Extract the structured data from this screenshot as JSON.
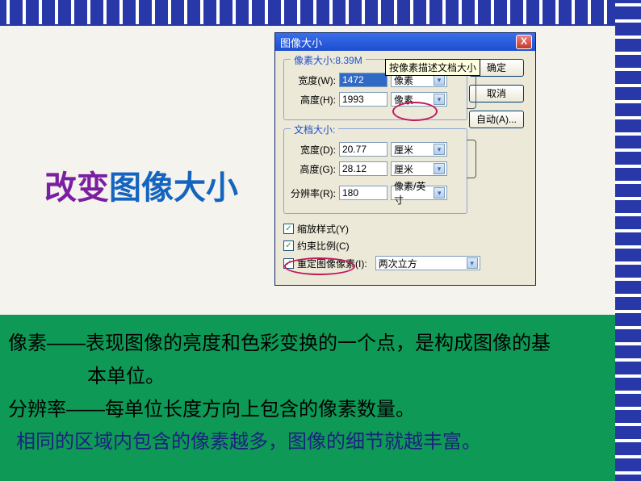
{
  "slide": {
    "title_part1": "改变",
    "title_part2": "图像大小"
  },
  "dialog": {
    "title": "图像大小",
    "close_label": "X"
  },
  "pixel_section": {
    "legend": "像素大小:8.39M",
    "width_label": "宽度(W):",
    "width_value": "1472",
    "height_label": "高度(H):",
    "height_value": "1993",
    "unit_width": "像素",
    "unit_height": "像素",
    "tooltip": "按像素描述文档大小"
  },
  "doc_section": {
    "legend": "文档大小:",
    "width_label": "宽度(D):",
    "width_value": "20.77",
    "height_label": "高度(G):",
    "height_value": "28.12",
    "res_label": "分辨率(R):",
    "res_value": "180",
    "unit_dim": "厘米",
    "unit_res": "像素/英寸"
  },
  "checkboxes": {
    "scale_styles": "缩放样式(Y)",
    "constrain": "约束比例(C)",
    "resample": "重定图像像素(I):",
    "resample_method": "两次立方"
  },
  "buttons": {
    "ok": "确定",
    "cancel": "取消",
    "auto": "自动(A)..."
  },
  "explanation": {
    "line1a": "像素——表现图像的亮度和色彩变换的一个点，是构成图像的基",
    "line1b": "本单位。",
    "line2": "分辨率——每单位长度方向上包含的像素数量。",
    "line3": "相同的区域内包含的像素越多，图像的细节就越丰富。"
  }
}
